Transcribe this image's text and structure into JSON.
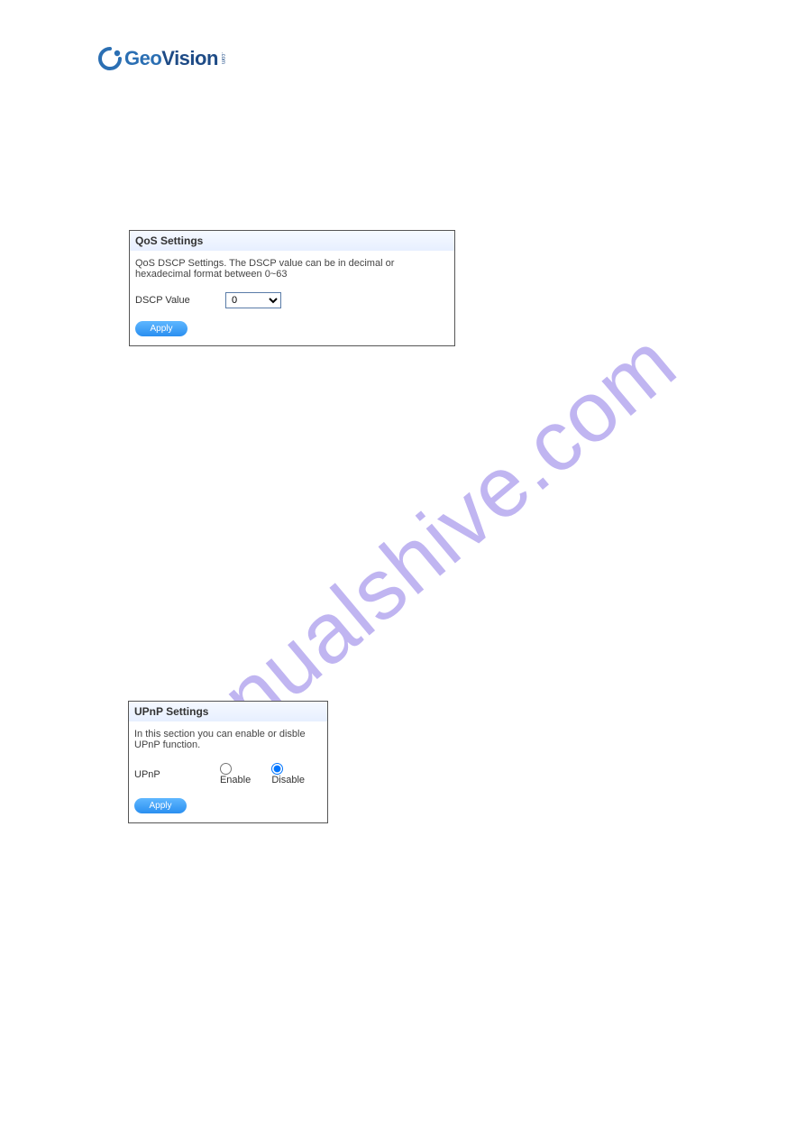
{
  "logo": {
    "geo": "Geo",
    "vision": "Vision",
    "side": ".com"
  },
  "watermark": "manualshive.com",
  "qos": {
    "title": "QoS Settings",
    "description": "QoS DSCP Settings. The DSCP value can be in decimal or hexadecimal format between 0~63",
    "field_label": "DSCP Value",
    "field_value": "0",
    "apply_label": "Apply"
  },
  "upnp": {
    "title": "UPnP Settings",
    "description": "In this section you can enable or disble UPnP function.",
    "field_label": "UPnP",
    "enable_label": "Enable",
    "disable_label": "Disable",
    "selected": "disable",
    "apply_label": "Apply"
  }
}
